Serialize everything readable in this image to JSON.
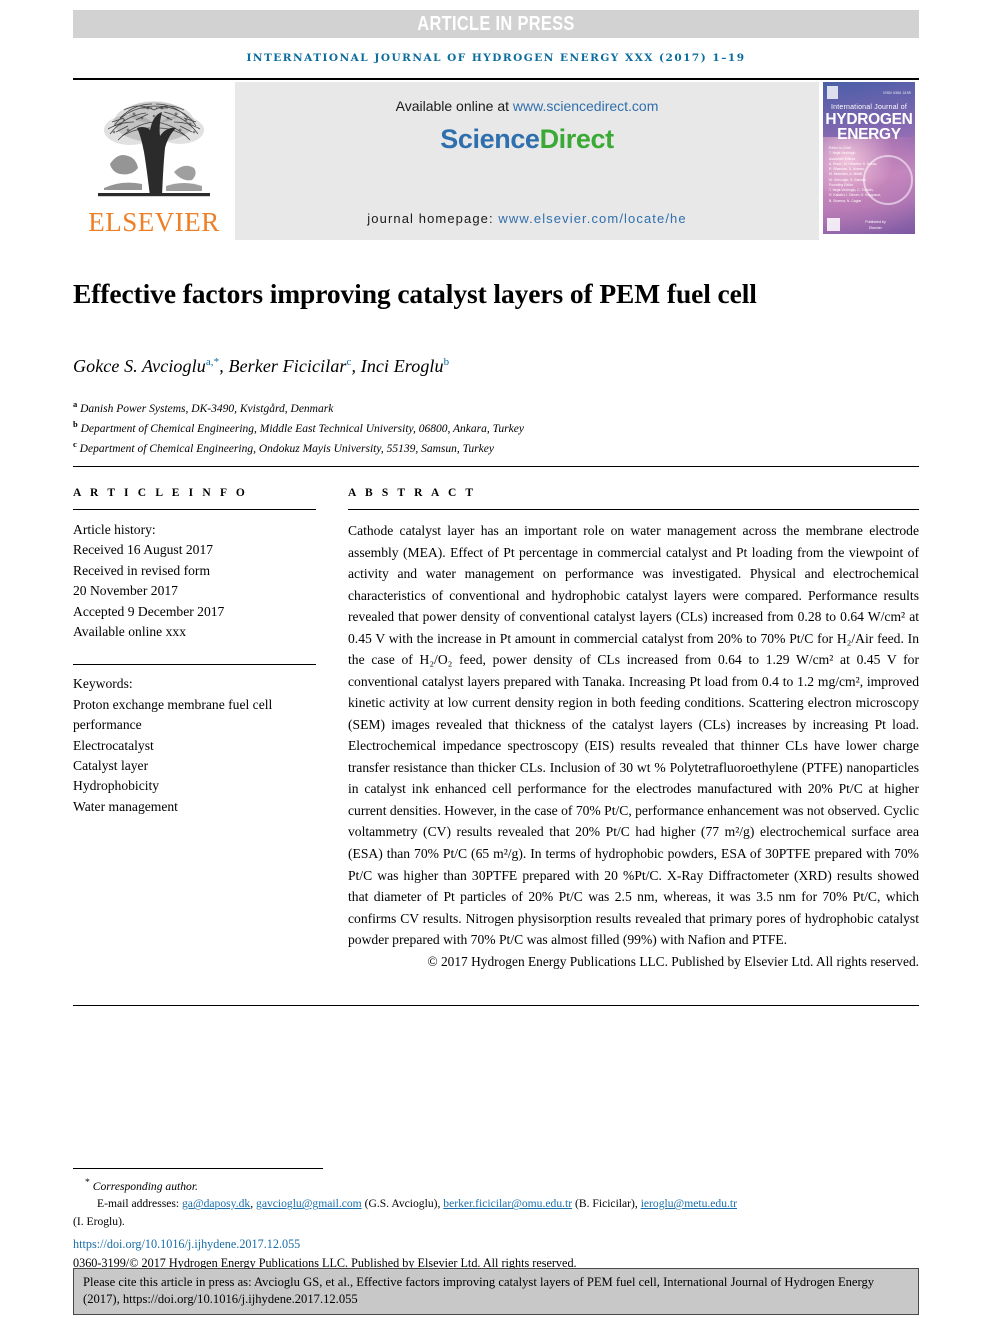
{
  "banner": {
    "text": "ARTICLE IN PRESS"
  },
  "running_head": {
    "text": "INTERNATIONAL JOURNAL OF HYDROGEN ENERGY XXX (2017) 1–19"
  },
  "masthead": {
    "publisher_name": "ELSEVIER",
    "available_prefix": "Available online at ",
    "available_url": "www.sciencedirect.com",
    "sciencedirect_part1": "Science",
    "sciencedirect_part2": "Direct",
    "homepage_prefix": "journal homepage: ",
    "homepage_url": "www.elsevier.com/locate/he",
    "cover": {
      "issn_text": "ISSN 0360-3199",
      "line_small": "International Journal of",
      "line_big_1": "HYDROGEN",
      "line_big_2": "ENERGY",
      "editor_block": "Editor-in-Chief\nT. Nejat Veziroglu\nAssociate Editors\nA. Ersoz, M. Hirscher, S. Kakac,\nR. Bhandari, D. Akansu,\nM. Momirlan, A. Midilli,\nM. Gencoglu, S. Kamalu\nFounding Editor\nT. Nejat Veziroglu, C. Turkish,\nH. Kabalci, I. Dincer, O. Kaygusuz,\nB. Sharma, N. Caglar",
      "publisher_footer": "Published by\nElsevier"
    }
  },
  "article": {
    "title": "Effective factors improving catalyst layers of PEM fuel cell",
    "authors": [
      {
        "name": "Gokce S. Avcioglu",
        "marks": "a,*"
      },
      {
        "name": "Berker Ficicilar",
        "marks": "c"
      },
      {
        "name": "Inci Eroglu",
        "marks": "b"
      }
    ],
    "affiliations": [
      {
        "mark": "a",
        "text": "Danish Power Systems, DK-3490, Kvistgård, Denmark"
      },
      {
        "mark": "b",
        "text": "Department of Chemical Engineering, Middle East Technical University, 06800, Ankara, Turkey"
      },
      {
        "mark": "c",
        "text": "Department of Chemical Engineering, Ondokuz Mayis University, 55139, Samsun, Turkey"
      }
    ]
  },
  "article_info": {
    "heading": "A R T I C L E   I N F O",
    "history_label": "Article history:",
    "history_lines": [
      "Received 16 August 2017",
      "Received in revised form",
      "20 November 2017",
      "Accepted 9 December 2017",
      "Available online xxx"
    ],
    "keywords_label": "Keywords:",
    "keywords": [
      "Proton exchange membrane fuel cell",
      "performance",
      "Electrocatalyst",
      "Catalyst layer",
      "Hydrophobicity",
      "Water management"
    ]
  },
  "abstract": {
    "heading": "A B S T R A C T",
    "body": "Cathode catalyst layer has an important role on water management across the membrane electrode assembly (MEA). Effect of Pt percentage in commercial catalyst and Pt loading from the viewpoint of activity and water management on performance was investigated. Physical and electrochemical characteristics of conventional and hydrophobic catalyst layers were compared. Performance results revealed that power density of conventional catalyst layers (CLs) increased from 0.28 to 0.64 W/cm² at 0.45 V with the increase in Pt amount in commercial catalyst from 20% to 70% Pt/C for H₂/Air feed. In the case of H₂/O₂ feed, power density of CLs increased from 0.64 to 1.29 W/cm² at 0.45 V for conventional catalyst layers prepared with Tanaka. Increasing Pt load from 0.4 to 1.2 mg/cm², improved kinetic activity at low current density region in both feeding conditions. Scattering electron microscopy (SEM) images revealed that thickness of the catalyst layers (CLs) increases by increasing Pt load. Electrochemical impedance spectroscopy (EIS) results revealed that thinner CLs have lower charge transfer resistance than thicker CLs. Inclusion of 30 wt % Polytetrafluoroethylene (PTFE) nanoparticles in catalyst ink enhanced cell performance for the electrodes manufactured with 20% Pt/C at higher current densities. However, in the case of 70% Pt/C, performance enhancement was not observed. Cyclic voltammetry (CV) results revealed that 20% Pt/C had higher (77 m²/g) electrochemical surface area (ESA) than 70% Pt/C (65 m²/g). In terms of hydrophobic powders, ESA of 30PTFE prepared with 70% Pt/C was higher than 30PTFE prepared with 20 %Pt/C. X-Ray Diffractometer (XRD) results showed that diameter of Pt particles of 20% Pt/C was 2.5 nm, whereas, it was 3.5 nm for 70% Pt/C, which confirms CV results. Nitrogen physisorption results revealed that primary pores of hydrophobic catalyst powder prepared with 70% Pt/C was almost filled (99%) with Nafion and PTFE.",
    "copyright": "© 2017 Hydrogen Energy Publications LLC. Published by Elsevier Ltd. All rights reserved."
  },
  "footnotes": {
    "corresponding": "Corresponding author.",
    "corresponding_mark": "*",
    "email_label": "E-mail addresses: ",
    "emails": [
      {
        "address": "ga@daposy.dk",
        "sep": ", "
      },
      {
        "address": "gavcioglu@gmail.com",
        "owner": " (G.S. Avcioglu), "
      },
      {
        "address": "berker.ficicilar@omu.edu.tr",
        "owner": " (B. Ficicilar), "
      },
      {
        "address": "ieroglu@metu.edu.tr",
        "owner": ""
      }
    ],
    "email_tail": "(I. Eroglu).",
    "doi": "https://doi.org/10.1016/j.ijhydene.2017.12.055",
    "issn_line": "0360-3199/© 2017 Hydrogen Energy Publications LLC. Published by Elsevier Ltd. All rights reserved."
  },
  "citation_box": {
    "text": "Please cite this article in press as: Avcioglu GS, et al., Effective factors improving catalyst layers of PEM fuel cell, International Journal of Hydrogen Energy (2017), https://doi.org/10.1016/j.ijhydene.2017.12.055"
  },
  "colors": {
    "banner_bg": "#d2d2d2",
    "running_head": "#0c6c9e",
    "link_blue": "#2f6fad",
    "sciencedirect_green": "#3aa935",
    "elsevier_orange": "#ee7f26",
    "sd_panel_bg": "#e8e8e8",
    "cite_box_bg": "#c8c8c8"
  }
}
